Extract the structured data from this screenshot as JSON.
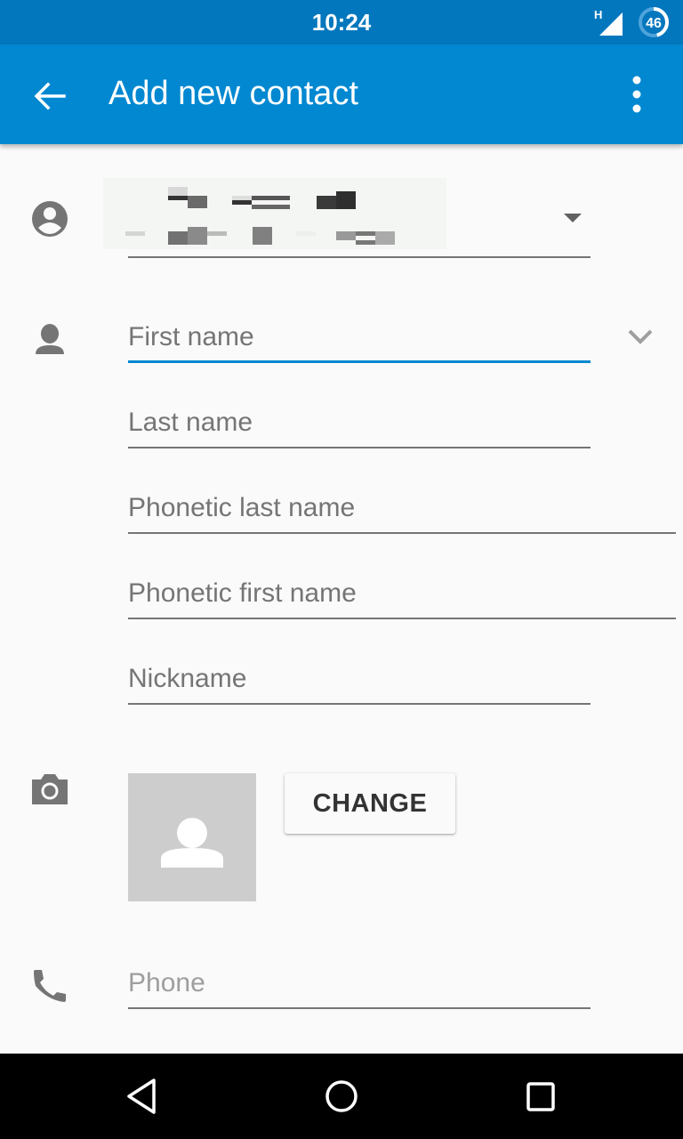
{
  "status_bar": {
    "time": "10:24",
    "network_type": "H",
    "battery_level": "46",
    "battery_fraction": 0.46,
    "icons": [
      "signal-icon",
      "battery-icon"
    ]
  },
  "app_bar": {
    "title": "Add new contact",
    "back_icon": "arrow-back-icon",
    "overflow_icon": "more-vert-icon",
    "background_color": "#0288d1"
  },
  "account": {
    "icon": "account-circle-icon",
    "value": "[redacted account]",
    "dropdown_icon": "arrow-drop-down-icon"
  },
  "name_fields": {
    "icon": "person-icon",
    "expand_icon": "expand-more-icon",
    "fields": [
      {
        "name": "first-name",
        "placeholder": "First name",
        "value": "",
        "focused": true
      },
      {
        "name": "last-name",
        "placeholder": "Last name",
        "value": ""
      },
      {
        "name": "phonetic-last-name",
        "placeholder": "Phonetic last name",
        "value": ""
      },
      {
        "name": "phonetic-first-name",
        "placeholder": "Phonetic first name",
        "value": ""
      },
      {
        "name": "nickname",
        "placeholder": "Nickname",
        "value": ""
      }
    ]
  },
  "photo": {
    "icon": "camera-icon",
    "placeholder_icon": "person-silhouette-icon",
    "change_label": "CHANGE"
  },
  "phone": {
    "icon": "phone-icon",
    "placeholder": "Phone",
    "value": ""
  },
  "nav_bar": {
    "buttons": [
      "back",
      "home",
      "recents"
    ]
  },
  "colors": {
    "accent": "#0288d1",
    "status_bar": "#0277bd",
    "icon_gray": "#757575"
  }
}
